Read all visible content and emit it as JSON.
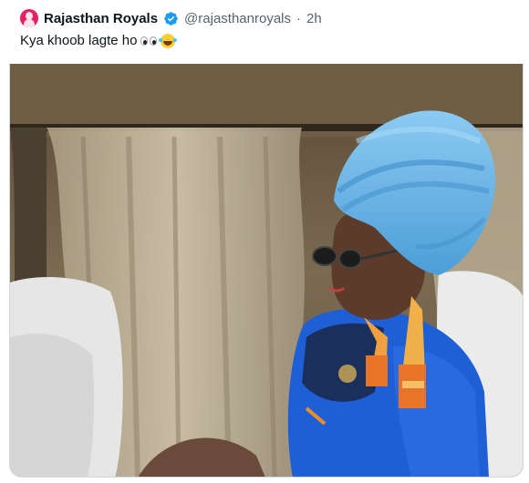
{
  "tweet": {
    "author_name": "Rajasthan Royals",
    "author_handle": "@rajasthanroyals",
    "separator": "·",
    "time": "2h",
    "text": "Kya khoob lagte ho",
    "avatar_icon": "rajasthan-royals-logo-icon",
    "verified_icon": "verified-badge-icon",
    "emoji": [
      "eyes-emoji-icon",
      "laughing-tears-emoji-icon"
    ]
  },
  "media": {
    "kind": "photo",
    "description_icon": "photo-player-turban"
  },
  "colors": {
    "verified": "#1d9bf0",
    "text": "#0f1419",
    "secondary": "#536471",
    "turban": "#5aaee0",
    "jersey": "#1f5fd6"
  }
}
